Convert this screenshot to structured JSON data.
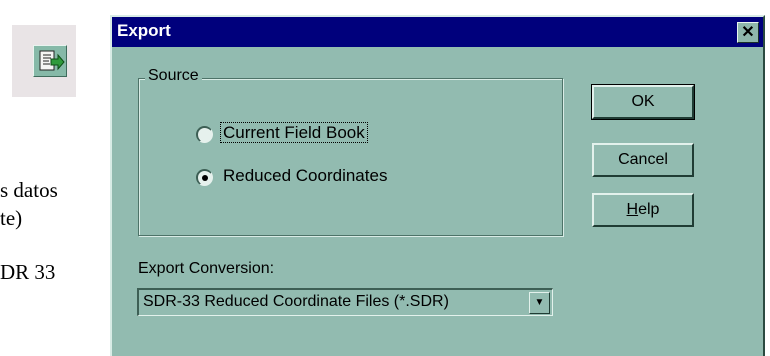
{
  "background_document": {
    "text_lines": [
      "s datos",
      "te)",
      "DR  33"
    ]
  },
  "dialog": {
    "title": "Export",
    "close_symbol": "✕",
    "source_group": {
      "label": "Source",
      "options": [
        {
          "label": "Current Field Book",
          "selected": false
        },
        {
          "label": "Reduced Coordinates",
          "selected": true
        }
      ]
    },
    "buttons": {
      "ok": "OK",
      "cancel": "Cancel",
      "help_mnemonic": "H",
      "help_rest": "elp"
    },
    "export_conversion": {
      "label": "Export Conversion:",
      "selected_value": "SDR-33 Reduced Coordinate Files (*.SDR)",
      "dropdown_symbol": "▼"
    }
  },
  "colors": {
    "dialog_face": "#92bbb0",
    "titlebar": "#00007c"
  }
}
